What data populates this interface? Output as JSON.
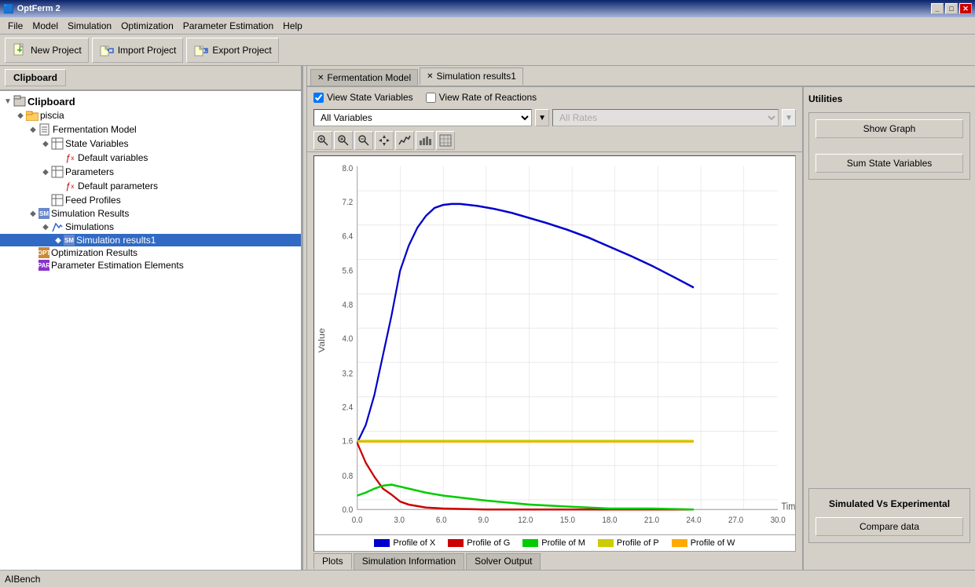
{
  "titleBar": {
    "title": "OptFerm 2",
    "windowTitle": "OptFerm 2",
    "btns": [
      "_",
      "□",
      "✕"
    ]
  },
  "menuBar": {
    "items": [
      "File",
      "Model",
      "Simulation",
      "Optimization",
      "Parameter Estimation",
      "Help"
    ]
  },
  "toolbar": {
    "buttons": [
      {
        "label": "New Project",
        "icon": "📄"
      },
      {
        "label": "Import Project",
        "icon": "📂"
      },
      {
        "label": "Export Project",
        "icon": "💾"
      }
    ]
  },
  "sidebar": {
    "tabLabel": "Clipboard",
    "tree": {
      "root": "Clipboard",
      "items": [
        {
          "id": "piscia",
          "label": "piscia",
          "level": 1,
          "icon": "folder",
          "expanded": true
        },
        {
          "id": "ferm-model",
          "label": "Fermentation Model",
          "level": 2,
          "icon": "doc",
          "expanded": false
        },
        {
          "id": "state-vars",
          "label": "State Variables",
          "level": 3,
          "icon": "grid",
          "expanded": true
        },
        {
          "id": "default-vars",
          "label": "Default variables",
          "level": 4,
          "icon": "fx"
        },
        {
          "id": "parameters",
          "label": "Parameters",
          "level": 3,
          "icon": "grid",
          "expanded": true
        },
        {
          "id": "default-params",
          "label": "Default parameters",
          "level": 4,
          "icon": "fx"
        },
        {
          "id": "feed-profiles",
          "label": "Feed Profiles",
          "level": 3,
          "icon": "grid"
        },
        {
          "id": "sim-results",
          "label": "Simulation Results",
          "level": 2,
          "icon": "sm",
          "expanded": true
        },
        {
          "id": "simulations",
          "label": "Simulations",
          "level": 3,
          "icon": "pencil",
          "expanded": true
        },
        {
          "id": "sim-results1",
          "label": "Simulation results1",
          "level": 4,
          "icon": "sm",
          "selected": true
        },
        {
          "id": "opt-results",
          "label": "Optimization Results",
          "level": 2,
          "icon": "opt"
        },
        {
          "id": "param-est",
          "label": "Parameter Estimation Elements",
          "level": 2,
          "icon": "par"
        }
      ]
    }
  },
  "tabs": [
    {
      "label": "Fermentation Model",
      "active": false,
      "closeable": true
    },
    {
      "label": "Simulation results1",
      "active": true,
      "closeable": true
    }
  ],
  "controls": {
    "viewStateVariables": {
      "label": "View State Variables",
      "checked": true
    },
    "viewRateOfReactions": {
      "label": "View Rate of Reactions",
      "checked": false
    },
    "variablesDropdown": {
      "value": "All Variables",
      "options": [
        "All Variables"
      ]
    },
    "ratesDropdown": {
      "value": "All Rates",
      "options": [
        "All Rates"
      ],
      "disabled": true
    }
  },
  "graphTools": [
    "🔍",
    "🔍",
    "🖱",
    "↔",
    "📈",
    "📊",
    "⊞"
  ],
  "graph": {
    "yLabel": "Value",
    "xLabel": "Time",
    "yAxis": [
      "8.0",
      "7.2",
      "6.4",
      "5.6",
      "4.8",
      "4.0",
      "3.2",
      "2.4",
      "1.6",
      "0.8",
      "0.0"
    ],
    "xAxis": [
      "0.0",
      "3.0",
      "6.0",
      "9.0",
      "12.0",
      "15.0",
      "18.0",
      "21.0",
      "24.0",
      "27.0",
      "30.0"
    ]
  },
  "legend": [
    {
      "label": "Profile of X",
      "color": "#0000cc"
    },
    {
      "label": "Profile of G",
      "color": "#cc0000"
    },
    {
      "label": "Profile of M",
      "color": "#00cc00"
    },
    {
      "label": "Profile of P",
      "color": "#cccc00"
    },
    {
      "label": "Profile of W",
      "color": "#ffaa00"
    }
  ],
  "bottomTabs": [
    {
      "label": "Plots",
      "active": true
    },
    {
      "label": "Simulation Information",
      "active": false
    },
    {
      "label": "Solver Output",
      "active": false
    }
  ],
  "utilities": {
    "title": "Utilities",
    "groups": [
      {
        "btn": "Show Graph",
        "section": "Sum State Variables"
      },
      {
        "sectionTitle": "Simulated Vs Experimental",
        "btn": "Compare data"
      }
    ]
  },
  "statusBar": {
    "text": "AIBench"
  }
}
